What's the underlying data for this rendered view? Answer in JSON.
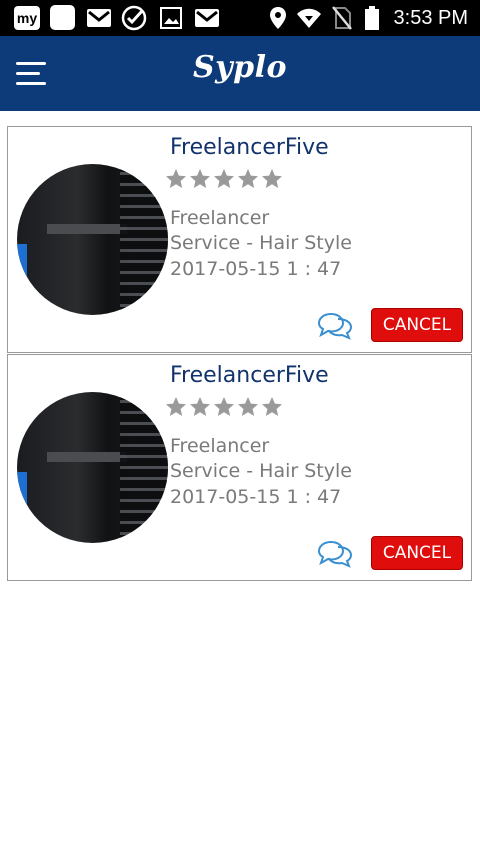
{
  "status_bar": {
    "time": "3:53 PM",
    "icons": [
      "my-app-icon",
      "app-square-icon",
      "gmail-icon",
      "check-icon",
      "image-icon",
      "gmail-icon",
      "location-icon",
      "wifi-icon",
      "no-sim-icon",
      "battery-icon"
    ],
    "my_label": "my"
  },
  "app_bar": {
    "title": "Syplo",
    "color": "#0d3a78",
    "menu_icon": "hamburger-menu-icon"
  },
  "bookings": [
    {
      "name": "FreelancerFive",
      "rating": 0,
      "max_rating": 5,
      "role": "Freelancer",
      "service": "Service - Hair Style",
      "datetime": "2017-05-15 1 : 47",
      "chat_icon": "chat-bubbles-icon",
      "cancel_label": "CANCEL"
    },
    {
      "name": "FreelancerFive",
      "rating": 0,
      "max_rating": 5,
      "role": "Freelancer",
      "service": "Service - Hair Style",
      "datetime": "2017-05-15 1 : 47",
      "chat_icon": "chat-bubbles-icon",
      "cancel_label": "CANCEL"
    }
  ],
  "colors": {
    "name": "#12336b",
    "cancel_bg": "#e00d0d",
    "star": "#9a9a9a",
    "chat_icon": "#3a8fd0"
  }
}
